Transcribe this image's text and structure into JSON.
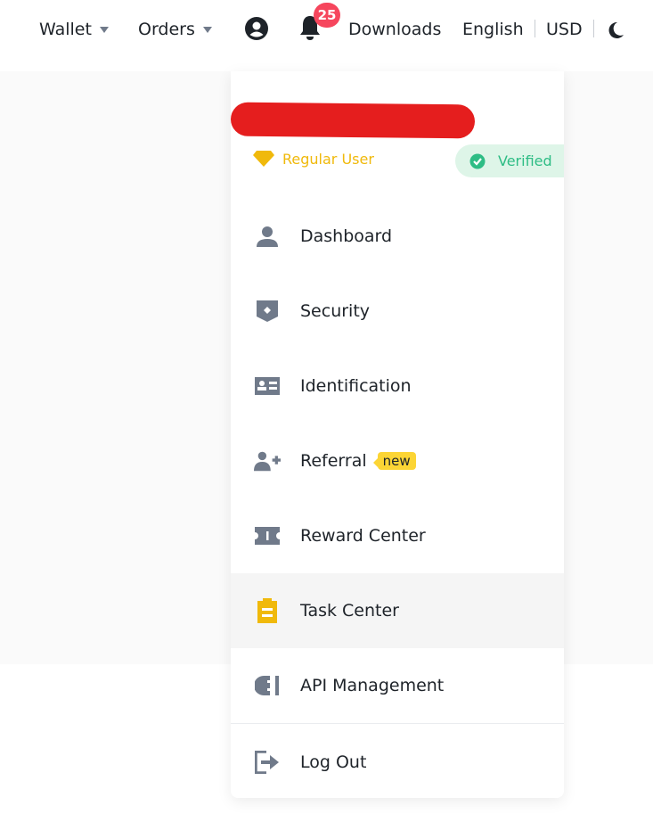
{
  "header": {
    "wallet": "Wallet",
    "orders": "Orders",
    "notifications_count": "25",
    "downloads": "Downloads",
    "language": "English",
    "currency": "USD"
  },
  "menu": {
    "user_type": "Regular User",
    "verified": "Verified",
    "items": [
      {
        "label": "Dashboard",
        "icon": "user-icon"
      },
      {
        "label": "Security",
        "icon": "shield-icon"
      },
      {
        "label": "Identification",
        "icon": "id-card-icon"
      },
      {
        "label": "Referral",
        "icon": "user-plus-icon",
        "badge": "new"
      },
      {
        "label": "Reward Center",
        "icon": "ticket-icon"
      },
      {
        "label": "Task Center",
        "icon": "clipboard-icon",
        "active": true
      },
      {
        "label": "API Management",
        "icon": "plug-icon"
      }
    ],
    "logout": "Log Out"
  },
  "colors": {
    "accent": "#f0b90b",
    "verified": "#2ebd85",
    "badge": "#f6465d",
    "icon": "#707a8a"
  }
}
